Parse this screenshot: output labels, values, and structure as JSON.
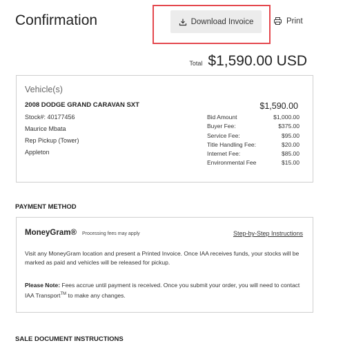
{
  "page": {
    "title": "Confirmation"
  },
  "toolbar": {
    "download_label": "Download Invoice",
    "print_label": "Print",
    "highlight_color": "#e4474d"
  },
  "total": {
    "label": "Total",
    "value": "$1,590.00 USD"
  },
  "vehicles": {
    "heading": "Vehicle(s)",
    "name": "2008 DODGE GRAND CARAVAN SXT",
    "stock": "Stock#: 40177456",
    "owner": "Maurice Mbata",
    "pickup": "Rep Pickup (Tower)",
    "location": "Appleton",
    "price": "$1,590.00",
    "fees": [
      {
        "label": "Bid Amount",
        "value": "$1,000.00"
      },
      {
        "label": "Buyer Fee:",
        "value": "$375.00"
      },
      {
        "label": "Service Fee:",
        "value": "$95.00"
      },
      {
        "label": "Title Handling Fee:",
        "value": "$20.00"
      },
      {
        "label": "Internet Fee:",
        "value": "$85.00"
      },
      {
        "label": "Environmental Fee",
        "value": "$15.00"
      }
    ]
  },
  "payment": {
    "heading": "PAYMENT METHOD",
    "method_name": "MoneyGram®",
    "fees_note": "Processing fees may apply",
    "instructions_link": "Step-by-Step Instructions",
    "description": "Visit any MoneyGram location and present a Printed Invoice. Once IAA receives funds, your stocks will be marked as paid and vehicles will be released for pickup.",
    "note_label": "Please Note:",
    "note_text": " Fees accrue until payment is received. Once you submit your order, you will need to contact IAA Transport",
    "note_tm": "TM",
    "note_end": " to make any changes."
  },
  "sale_docs": {
    "heading": "SALE DOCUMENT INSTRUCTIONS"
  }
}
